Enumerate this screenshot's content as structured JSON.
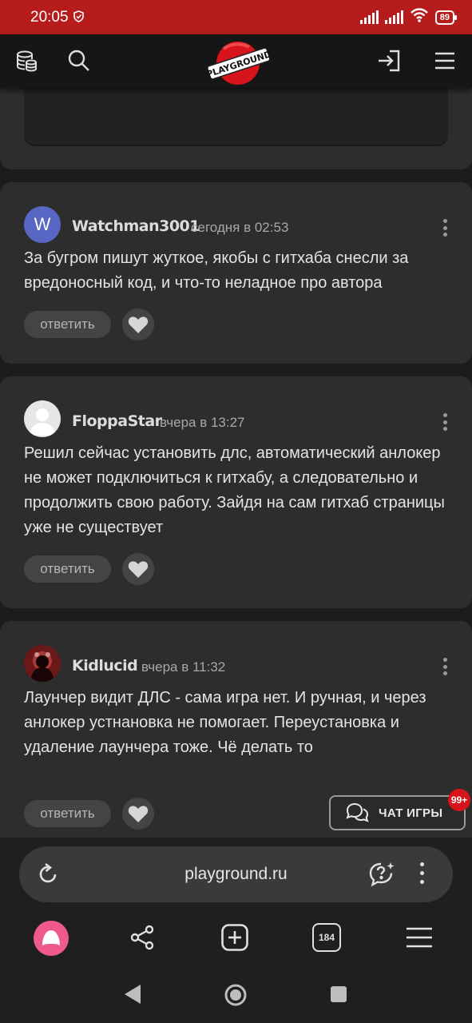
{
  "status_bar": {
    "time": "20:05",
    "battery": "89"
  },
  "header": {
    "logo_text": "PLAYGROUND"
  },
  "comments": [
    {
      "avatar_letter": "W",
      "author": "Watchman3001",
      "date": "сегодня в 02:53",
      "text": "За бугром пишут жуткое, якобы с гитхаба снесли за вредоносный код, и что-то неладное про автора",
      "reply_label": "ответить"
    },
    {
      "author": "FloppaStar",
      "date": "вчера в 13:27",
      "text": "Решил сейчас установить длс, автоматический анлокер не может подключиться к гитхабу, а следовательно и продолжить свою работу. Зайдя на сам гитхаб страницы уже не существует",
      "reply_label": "ответить"
    },
    {
      "author": "Kidlucid",
      "date": "вчера в 11:32",
      "text": "Лаунчер видит ДЛС - сама игра нет. И ручная, и через анлокер устнановка не помогает. Переустановка и удаление лаунчера тоже. Чё делать то",
      "reply_label": "ответить"
    }
  ],
  "chat_button": {
    "label": "ЧАТ ИГРЫ",
    "badge": "99+"
  },
  "browser": {
    "url": "playground.ru",
    "tab_count": "184"
  },
  "colors": {
    "status_bar": "#b71c1c",
    "card": "#2d2d2d",
    "badge": "#d7141b",
    "accent_pink": "#ef5a8c"
  }
}
